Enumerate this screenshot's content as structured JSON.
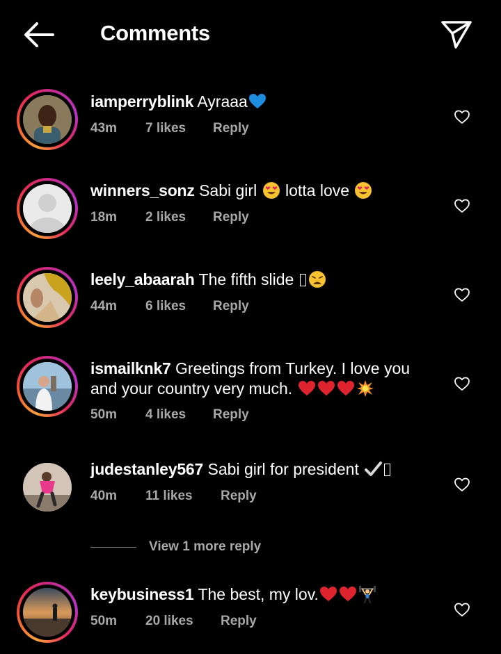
{
  "header": {
    "title": "Comments"
  },
  "comments": [
    {
      "username": "iamperryblink",
      "text": "Ayraaa",
      "time": "43m",
      "likes": "7 likes",
      "reply": "Reply"
    },
    {
      "username": "winners_sonz",
      "text_a": "Sabi girl",
      "text_b": "lotta love",
      "time": "18m",
      "likes": "2 likes",
      "reply": "Reply"
    },
    {
      "username": "leely_abaarah",
      "text": "The fifth slide",
      "time": "44m",
      "likes": "6 likes",
      "reply": "Reply"
    },
    {
      "username": "ismailknk7",
      "text": "Greetings from Turkey. I love you and your country very much.",
      "time": "50m",
      "likes": "4 likes",
      "reply": "Reply"
    },
    {
      "username": "judestanley567",
      "text": "Sabi girl for president",
      "time": "40m",
      "likes": "11 likes",
      "reply": "Reply"
    },
    {
      "username": "keybusiness1",
      "text": "The best, my lov.",
      "time": "50m",
      "likes": "20 likes",
      "reply": "Reply"
    }
  ],
  "view_more": "View 1 more reply",
  "icons": {
    "back": "arrow-left-icon",
    "send": "paper-plane-icon",
    "like": "heart-outline-icon"
  },
  "colors": {
    "background": "#000000",
    "text": "#ffffff",
    "meta": "#a8a8a8",
    "story_ring": "#e3265b"
  }
}
